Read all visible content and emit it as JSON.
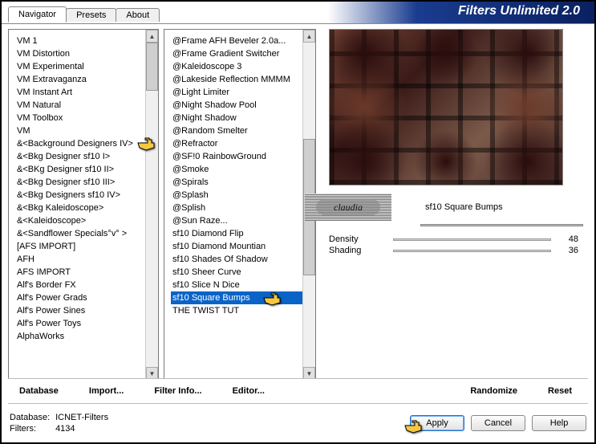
{
  "app": {
    "title": "Filters Unlimited 2.0"
  },
  "tabs": [
    {
      "label": "Navigator",
      "active": true
    },
    {
      "label": "Presets",
      "active": false
    },
    {
      "label": "About",
      "active": false
    }
  ],
  "categories": {
    "items": [
      "VM 1",
      "VM Distortion",
      "VM Experimental",
      "VM Extravaganza",
      "VM Instant Art",
      "VM Natural",
      "VM Toolbox",
      "VM",
      "&<Background Designers IV>",
      "&<Bkg Designer sf10 I>",
      "&<BKg Designer sf10 II>",
      "&<Bkg Designer sf10 III>",
      "&<Bkg Designers sf10 IV>",
      "&<Bkg Kaleidoscope>",
      "&<Kaleidoscope>",
      "&<Sandflower Specials°v° >",
      "[AFS IMPORT]",
      "AFH",
      "AFS IMPORT",
      "Alf's Border FX",
      "Alf's Power Grads",
      "Alf's Power Sines",
      "Alf's Power Toys",
      "AlphaWorks"
    ],
    "highlighted_index": 8
  },
  "filters": {
    "items": [
      "@Frame AFH Beveler 2.0a...",
      "@Frame Gradient Switcher",
      "@Kaleidoscope 3",
      "@Lakeside Reflection MMMM",
      "@Light Limiter",
      "@Night Shadow Pool",
      "@Night Shadow",
      "@Random Smelter",
      "@Refractor",
      "@SF!0 RainbowGround",
      "@Smoke",
      "@Spirals",
      "@Splash",
      "@Splish",
      "@Sun Raze...",
      "sf10 Diamond Flip",
      "sf10 Diamond Mountian",
      "sf10 Shades Of Shadow",
      "sf10 Sheer Curve",
      "sf10 Slice N Dice",
      "sf10 Square Bumps",
      "THE TWIST TUT"
    ],
    "selected_index": 20
  },
  "watermark": {
    "text": "claudia"
  },
  "selected_filter_name": "sf10 Square Bumps",
  "sliders": [
    {
      "label": "Density",
      "value": 48
    },
    {
      "label": "Shading",
      "value": 36
    }
  ],
  "buttons": {
    "database": "Database",
    "import": "Import...",
    "filter_info": "Filter Info...",
    "editor": "Editor...",
    "randomize": "Randomize",
    "reset": "Reset",
    "apply": "Apply",
    "cancel": "Cancel",
    "help": "Help"
  },
  "status": {
    "db_label": "Database:",
    "db_value": "ICNET-Filters",
    "filters_label": "Filters:",
    "filters_value": "4134"
  }
}
